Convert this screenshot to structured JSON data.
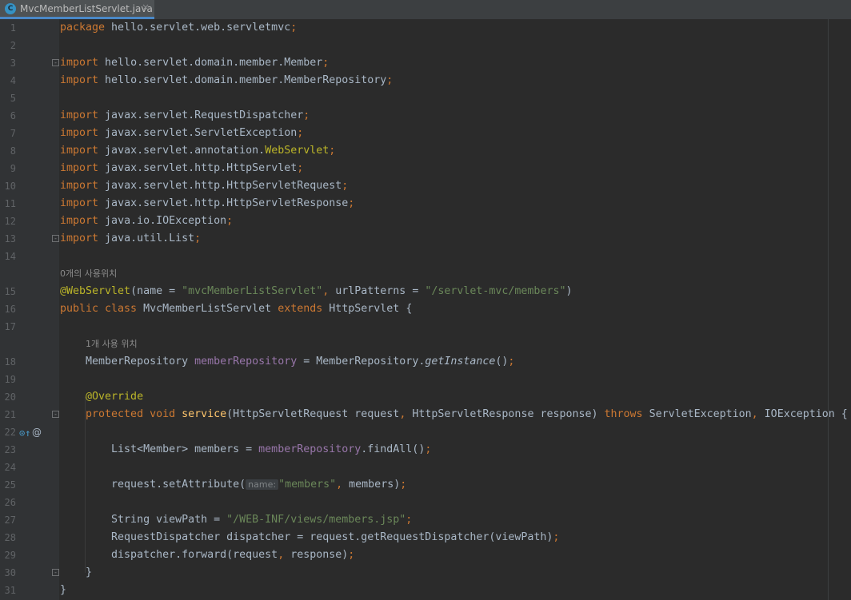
{
  "tab": {
    "icon_letter": "C",
    "filename": "MvcMemberListServlet.java",
    "close_glyph": "×"
  },
  "gutter": {
    "line_numbers": [
      "1",
      "2",
      "3",
      "4",
      "5",
      "6",
      "7",
      "8",
      "9",
      "10",
      "11",
      "12",
      "13",
      "14",
      "15",
      "16",
      "17",
      "18",
      "19",
      "20",
      "21",
      "22",
      "23",
      "24",
      "25",
      "26",
      "27",
      "28",
      "29",
      "30",
      "31"
    ],
    "override_icon": "override-method-icon",
    "annotation_marker": "@"
  },
  "hints": {
    "class_usages": "0개의 사용위치",
    "field_usages": "1개 사용 위치",
    "param_name": "name:"
  },
  "code": {
    "l1": [
      [
        "k",
        "package"
      ],
      [
        "",
        ""
      ],
      [
        "",
        " hello.servlet.web.servletmvc"
      ],
      [
        "k",
        ";"
      ]
    ],
    "l3": [
      [
        "k",
        "import"
      ],
      [
        "",
        " hello.servlet.domain.member.Member"
      ],
      [
        "k",
        ";"
      ]
    ],
    "l4": [
      [
        "k",
        "import"
      ],
      [
        "",
        " hello.servlet.domain.member.MemberRepository"
      ],
      [
        "k",
        ";"
      ]
    ],
    "l6": [
      [
        "k",
        "import"
      ],
      [
        "",
        " javax.servlet.RequestDispatcher"
      ],
      [
        "k",
        ";"
      ]
    ],
    "l7": [
      [
        "k",
        "import"
      ],
      [
        "",
        " javax.servlet.ServletException"
      ],
      [
        "k",
        ";"
      ]
    ],
    "l8": [
      [
        "k",
        "import"
      ],
      [
        "",
        " javax.servlet.annotation."
      ],
      [
        "a",
        "WebServlet"
      ],
      [
        "k",
        ";"
      ]
    ],
    "l9": [
      [
        "k",
        "import"
      ],
      [
        "",
        " javax.servlet.http.HttpServlet"
      ],
      [
        "k",
        ";"
      ]
    ],
    "l10": [
      [
        "k",
        "import"
      ],
      [
        "",
        " javax.servlet.http.HttpServletRequest"
      ],
      [
        "k",
        ";"
      ]
    ],
    "l11": [
      [
        "k",
        "import"
      ],
      [
        "",
        " javax.servlet.http.HttpServletResponse"
      ],
      [
        "k",
        ";"
      ]
    ],
    "l12": [
      [
        "k",
        "import"
      ],
      [
        "",
        " java.io.IOException"
      ],
      [
        "k",
        ";"
      ]
    ],
    "l13": [
      [
        "k",
        "import"
      ],
      [
        "",
        " java.util.List"
      ],
      [
        "k",
        ";"
      ]
    ],
    "l15": [
      [
        "a",
        "@WebServlet"
      ],
      [
        "",
        "(name = "
      ],
      [
        "s",
        "\"mvcMemberListServlet\""
      ],
      [
        "k",
        ","
      ],
      [
        "",
        " urlPatterns = "
      ],
      [
        "s",
        "\"/servlet-mvc/members\""
      ],
      [
        "",
        ")"
      ]
    ],
    "l16": [
      [
        "k",
        "public class"
      ],
      [
        "",
        " MvcMemberListServlet "
      ],
      [
        "k",
        "extends"
      ],
      [
        "",
        " HttpServlet {"
      ]
    ],
    "l18": [
      [
        "",
        "    MemberRepository "
      ],
      [
        "f",
        "memberRepository"
      ],
      [
        "",
        " = MemberRepository."
      ],
      [
        "it",
        "getInstance"
      ],
      [
        "",
        "()"
      ],
      [
        "k",
        ";"
      ]
    ],
    "l20": [
      [
        "a",
        "    @Override"
      ]
    ],
    "l21": [
      [
        "k",
        "    protected void"
      ],
      [
        "",
        " "
      ],
      [
        "m",
        "service"
      ],
      [
        "",
        "(HttpServletRequest request"
      ],
      [
        "k",
        ","
      ],
      [
        "",
        " HttpServletResponse response) "
      ],
      [
        "k",
        "throws"
      ],
      [
        "",
        " ServletException"
      ],
      [
        "k",
        ","
      ],
      [
        "",
        " IOException {"
      ]
    ],
    "l23": [
      [
        "",
        "        List<Member> members = "
      ],
      [
        "f",
        "memberRepository"
      ],
      [
        "",
        ".findAll()"
      ],
      [
        "k",
        ";"
      ]
    ],
    "l25": [
      [
        "",
        "        request.setAttribute("
      ],
      [
        "ph",
        "name:"
      ],
      [
        "s",
        "\"members\""
      ],
      [
        "k",
        ","
      ],
      [
        "",
        " members)"
      ],
      [
        "k",
        ";"
      ]
    ],
    "l27": [
      [
        "",
        "        String viewPath = "
      ],
      [
        "s",
        "\"/WEB-INF/views/members.jsp\""
      ],
      [
        "k",
        ";"
      ]
    ],
    "l28": [
      [
        "",
        "        RequestDispatcher dispatcher = request.getRequestDispatcher(viewPath)"
      ],
      [
        "k",
        ";"
      ]
    ],
    "l29": [
      [
        "",
        "        dispatcher.forward(request"
      ],
      [
        "k",
        ","
      ],
      [
        "",
        " response)"
      ],
      [
        "k",
        ";"
      ]
    ],
    "l30": [
      [
        "",
        "    }"
      ]
    ],
    "l31": [
      [
        "",
        "}"
      ]
    ]
  }
}
